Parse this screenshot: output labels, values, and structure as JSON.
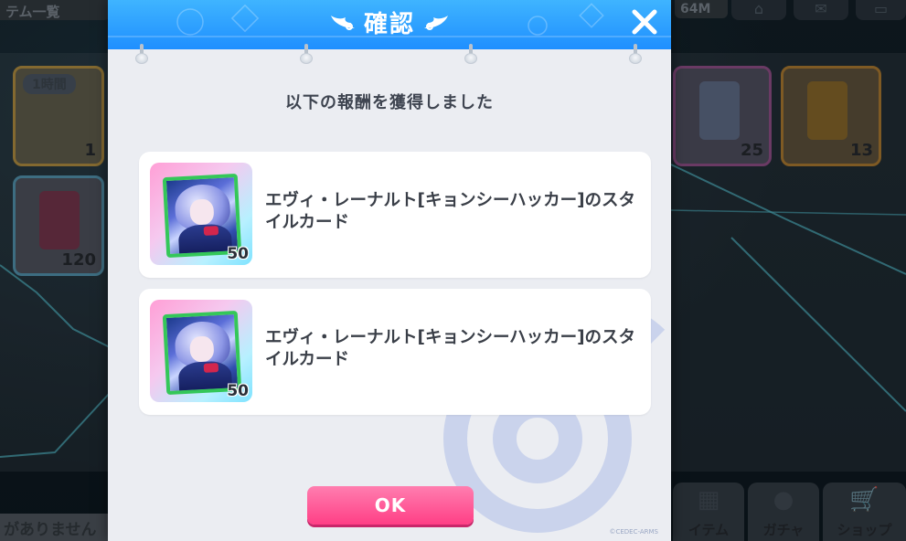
{
  "background": {
    "top_left_label": "テム一覧",
    "memory_label": "64M",
    "bottom_left_text": "がありません",
    "tag_label": "1時間",
    "cards": [
      {
        "count": "1"
      },
      {
        "count": "120"
      },
      {
        "count": "25"
      },
      {
        "count": "13"
      }
    ],
    "nav_tabs": [
      {
        "label": "イテム",
        "icon": "item-icon"
      },
      {
        "label": "ガチャ",
        "icon": "gacha-icon"
      },
      {
        "label": "ショップ",
        "icon": "shop-icon"
      }
    ]
  },
  "dialog": {
    "title": "確認",
    "subtitle": "以下の報酬を獲得しました",
    "close_icon": "close-icon",
    "ok_label": "OK",
    "copyright": "©CEDEC-ARMS",
    "rewards": [
      {
        "name": "エヴィ・レーナルト[キョンシーハッカー]のスタイルカード",
        "quantity": "50",
        "icon": "style-card-icon"
      },
      {
        "name": "エヴィ・レーナルト[キョンシーハッカー]のスタイルカード",
        "quantity": "50",
        "icon": "style-card-icon"
      }
    ]
  },
  "colors": {
    "header_blue": "#1f8fff",
    "ok_pink": "#ff3f86",
    "card_border_green": "#34c759"
  }
}
